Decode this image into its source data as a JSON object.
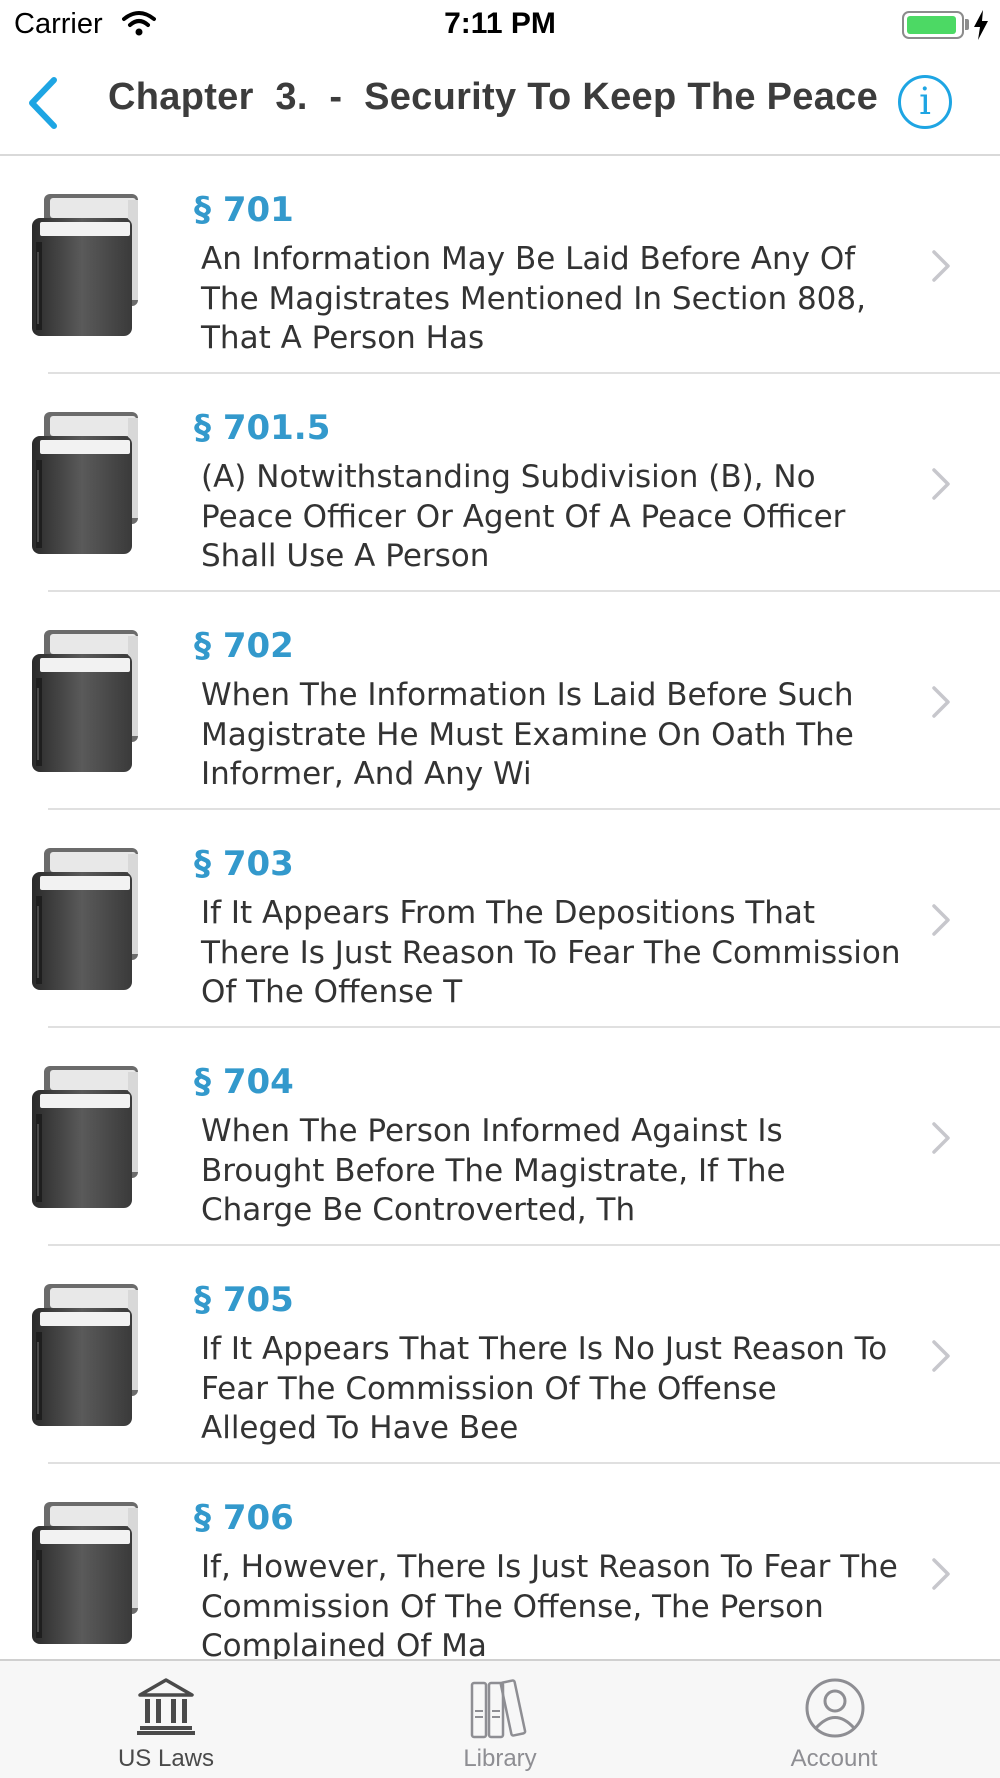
{
  "status_bar": {
    "carrier": "Carrier",
    "time": "7:11 PM",
    "battery_level": 0.95
  },
  "nav": {
    "back_icon": "chevron-left-icon",
    "title": "Chapter  3.  -  Security To Keep The Peace",
    "info_icon": "info-icon",
    "info_glyph": "i",
    "accent": "#1ea5e3"
  },
  "list": {
    "section_color": "#3399cc",
    "items": [
      {
        "section": "§ 701",
        "text": "An Information May Be Laid Before Any Of The Magistrates Mentioned In Section 808, That A Person Has"
      },
      {
        "section": "§ 701.5",
        "text": "(A) Notwithstanding Subdivision (B), No Peace Officer Or Agent Of A Peace Officer Shall Use A Person"
      },
      {
        "section": "§ 702",
        "text": "When The Information Is Laid Before Such Magistrate He Must Examine On Oath The Informer, And Any Wi"
      },
      {
        "section": "§ 703",
        "text": "If It Appears From The Depositions That There Is Just Reason To Fear The Commission Of The Offense T"
      },
      {
        "section": "§ 704",
        "text": "When The Person Informed Against Is Brought Before The Magistrate, If The Charge Be Controverted, Th"
      },
      {
        "section": "§ 705",
        "text": "If It Appears That There Is No Just Reason To Fear The Commission Of The Offense Alleged To Have Bee"
      },
      {
        "section": "§ 706",
        "text": "If, However, There Is Just Reason To Fear The Commission Of The Offense, The Person Complained Of Ma"
      }
    ]
  },
  "tab_bar": {
    "active_color": "#4a4a4a",
    "inactive_color": "#8e8e93",
    "tabs": [
      {
        "label": "US Laws",
        "icon": "courthouse-icon",
        "active": true
      },
      {
        "label": "Library",
        "icon": "books-icon",
        "active": false
      },
      {
        "label": "Account",
        "icon": "user-circle-icon",
        "active": false
      }
    ]
  }
}
